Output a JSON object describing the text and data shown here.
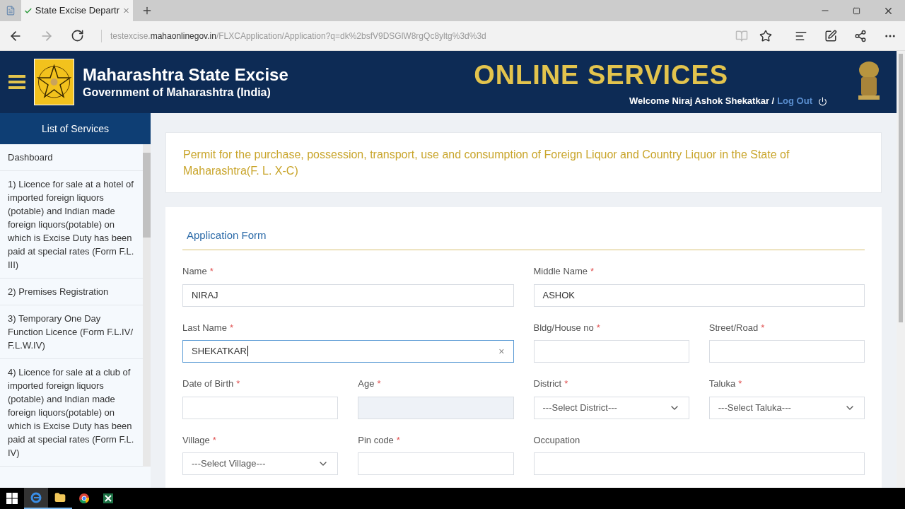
{
  "browser": {
    "tab_title": "State Excise Departr",
    "url_host_prefix": "testexcise.",
    "url_host": "mahaonlinegov.in",
    "url_path": "/FLXCApplication/Application?q=dk%2bsfV9DSGlW8rgQc8yltg%3d%3d"
  },
  "header": {
    "title": "Maharashtra State Excise",
    "subtitle": "Government of Maharashtra (India)",
    "banner": "ONLINE SERVICES",
    "welcome": "Welcome Niraj Ashok Shekatkar /",
    "logout": "Log Out"
  },
  "sidebar": {
    "heading": "List of Services",
    "items": [
      {
        "label": "Dashboard"
      },
      {
        "label": "1) Licence for sale at a hotel of imported foreign liquors (potable) and Indian made foreign liquors(potable) on which is Excise Duty has been paid at special rates (Form F.L. III)"
      },
      {
        "label": "2) Premises Registration"
      },
      {
        "label": "3) Temporary One Day Function Licence (Form F.L.IV/ F.L.W.IV)"
      },
      {
        "label": "4) Licence for sale at a club of imported foreign liquors (potable) and Indian made foreign liquors(potable) on which is Excise Duty has been paid at special rates (Form F.L. IV)"
      }
    ]
  },
  "page_title": "Permit for the purchase, possession, transport, use and consumption of Foreign Liquor and Country Liquor in the State of Maharashtra(F. L. X-C)",
  "form": {
    "title": "Application Form",
    "fields": [
      {
        "label": "Name",
        "required": true,
        "kind": "text",
        "value": "NIRAJ",
        "focused": false,
        "disabled": false
      },
      {
        "label": "Middle Name",
        "required": true,
        "kind": "text",
        "value": "ASHOK",
        "focused": false,
        "disabled": false
      },
      {
        "label": "Last Name",
        "required": true,
        "kind": "text",
        "value": "SHEKATKAR",
        "focused": true,
        "disabled": false,
        "clear": "×"
      },
      {
        "label": "Bldg/House no",
        "required": true,
        "kind": "text",
        "focused": false,
        "disabled": false
      },
      {
        "label": "Street/Road",
        "required": true,
        "kind": "text",
        "focused": false,
        "disabled": false
      },
      {
        "label": "Date of Birth",
        "required": true,
        "kind": "text",
        "focused": false,
        "disabled": false
      },
      {
        "label": "Age",
        "required": true,
        "kind": "text",
        "focused": false,
        "disabled": true
      },
      {
        "label": "District",
        "required": true,
        "kind": "select",
        "value": "---Select District---"
      },
      {
        "label": "Taluka",
        "required": true,
        "kind": "select",
        "value": "---Select Taluka---"
      },
      {
        "label": "Village",
        "required": true,
        "kind": "select",
        "value": "---Select Village---"
      },
      {
        "label": "Pin code",
        "required": true,
        "kind": "text",
        "focused": false,
        "disabled": false
      },
      {
        "label": "Occupation",
        "required": false,
        "kind": "text",
        "focused": false,
        "disabled": false
      }
    ]
  },
  "required_mark": "*"
}
